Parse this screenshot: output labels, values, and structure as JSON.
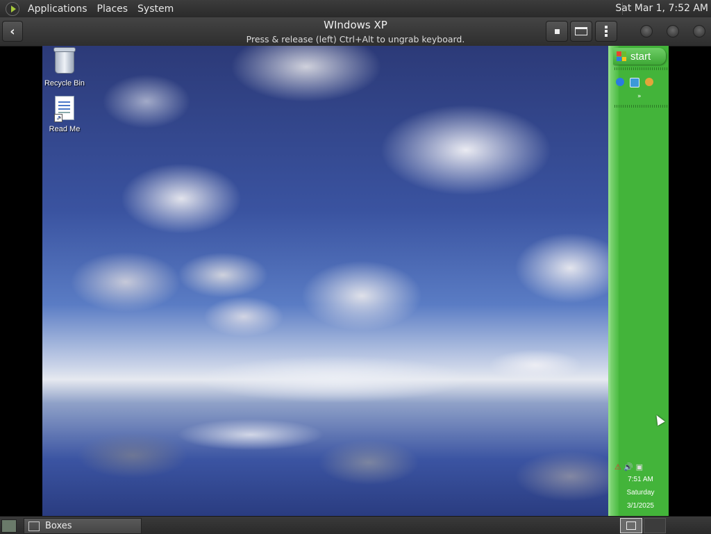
{
  "top_panel": {
    "menus": [
      "Applications",
      "Places",
      "System"
    ],
    "clock": "Sat Mar  1,  7:52 AM"
  },
  "boxes_header": {
    "title": "WIndows XP",
    "subtitle": "Press & release (left) Ctrl+Alt to ungrab keyboard.",
    "back_icon": "back-arrow-icon",
    "tool_icons": [
      "stop-icon",
      "keyboard-icon",
      "menu-icon"
    ]
  },
  "desktop": {
    "icons": [
      {
        "label": "Recycle Bin",
        "icon": "recycle-bin-icon"
      },
      {
        "label": "Read Me",
        "icon": "document-icon"
      }
    ]
  },
  "xp_taskbar": {
    "start_label": "start",
    "quick_launch": [
      "internet-explorer-icon",
      "show-desktop-icon",
      "media-player-icon"
    ],
    "tray_time": "7:51 AM",
    "tray_day": "Saturday",
    "tray_date": "3/1/2025",
    "colors": {
      "bar": "#43b43a",
      "start": "#3ea836"
    }
  },
  "bottom_panel": {
    "task_label": "Boxes"
  }
}
